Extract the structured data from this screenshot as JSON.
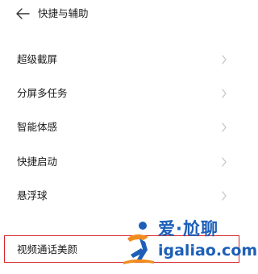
{
  "header": {
    "back_icon": "arrow-left-icon",
    "title": "快捷与辅助"
  },
  "menu": {
    "items": [
      {
        "label": "超级截屏",
        "icon": "chevron-right-icon"
      },
      {
        "label": "分屏多任务",
        "icon": "chevron-right-icon"
      },
      {
        "label": "智能体感",
        "icon": "chevron-right-icon"
      },
      {
        "label": "快捷启动",
        "icon": "chevron-right-icon"
      },
      {
        "label": "悬浮球",
        "icon": "chevron-right-icon"
      }
    ],
    "highlighted_item": {
      "label": "视频通话美颜",
      "highlight_color": "#d9262a"
    }
  },
  "watermark": {
    "text_top": "爱·尬聊",
    "text_bottom": "igaliao.com",
    "color": "#1d5fb8",
    "accent_color": "#f28c1e"
  }
}
